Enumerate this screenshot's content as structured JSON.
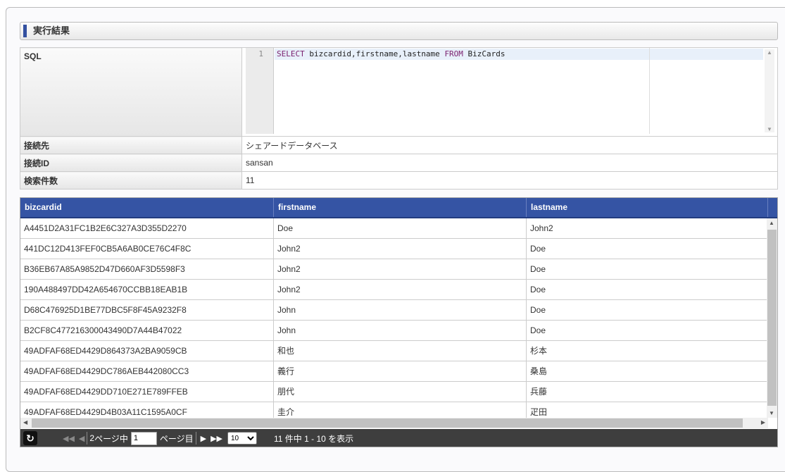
{
  "heading": "実行結果",
  "info": {
    "sql_label": "SQL",
    "sql_line": "1",
    "sql_keyword1": "SELECT",
    "sql_mid": " bizcardid,firstname,lastname ",
    "sql_keyword2": "FROM",
    "sql_end": " BizCards",
    "conn_label": "接続先",
    "conn_value": "シェアードデータベース",
    "connid_label": "接続ID",
    "connid_value": "sansan",
    "count_label": "検索件数",
    "count_value": "11"
  },
  "grid": {
    "columns": [
      "bizcardid",
      "firstname",
      "lastname"
    ],
    "rows": [
      [
        "A4451D2A31FC1B2E6C327A3D355D2270",
        "Doe",
        "John2"
      ],
      [
        "441DC12D413FEF0CB5A6AB0CE76C4F8C",
        "John2",
        "Doe"
      ],
      [
        "B36EB67A85A9852D47D660AF3D5598F3",
        "John2",
        "Doe"
      ],
      [
        "190A488497DD42A654670CCBB18EAB1B",
        "John2",
        "Doe"
      ],
      [
        "D68C476925D1BE77DBC5F8F45A9232F8",
        "John",
        "Doe"
      ],
      [
        "B2CF8C477216300043490D7A44B47022",
        "John",
        "Doe"
      ],
      [
        "49ADFAF68ED4429D864373A2BA9059CB",
        "和也",
        "杉本"
      ],
      [
        "49ADFAF68ED4429DC786AEB442080CC3",
        "義行",
        "桑島"
      ],
      [
        "49ADFAF68ED4429DD710E271E789FFEB",
        "朋代",
        "兵藤"
      ],
      [
        "49ADFAF68ED4429D4B03A11C1595A0CF",
        "圭介",
        "疋田"
      ]
    ]
  },
  "pager": {
    "total_pages": "2",
    "pages_of": "ページ中",
    "page_value": "1",
    "page_suffix": "ページ目",
    "page_size": "10",
    "summary": "11 件中 1 - 10 を表示"
  }
}
